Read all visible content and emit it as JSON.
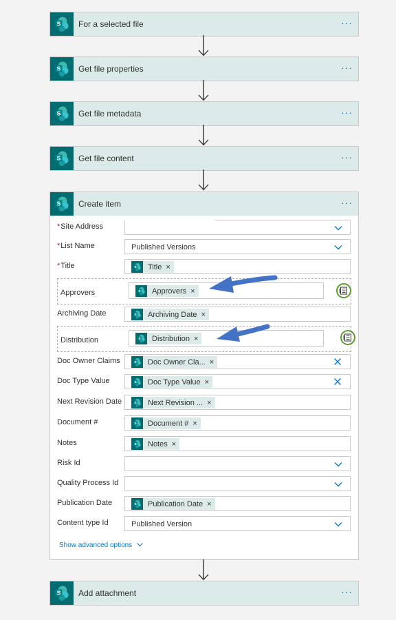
{
  "steps": [
    {
      "title": "For a selected file",
      "more": "···"
    },
    {
      "title": "Get file properties",
      "more": "···"
    },
    {
      "title": "Get file metadata",
      "more": "···"
    },
    {
      "title": "Get file content",
      "more": "···"
    }
  ],
  "create_item": {
    "title": "Create item",
    "more": "···",
    "required_mark": "*",
    "fields": {
      "site_address": {
        "label": "Site Address"
      },
      "list_name": {
        "label": "List Name",
        "value": "Published Versions"
      },
      "title": {
        "label": "Title",
        "token": "Title"
      },
      "approvers": {
        "label": "Approvers",
        "token": "Approvers"
      },
      "archiving_date": {
        "label": "Archiving Date",
        "token": "Archiving Date"
      },
      "distribution": {
        "label": "Distribution",
        "token": "Distribution"
      },
      "doc_owner_claims": {
        "label": "Doc Owner Claims",
        "token": "Doc Owner Cla..."
      },
      "doc_type_value": {
        "label": "Doc Type Value",
        "token": "Doc Type Value"
      },
      "next_revision_date": {
        "label": "Next Revision Date",
        "token": "Next Revision ..."
      },
      "document_number": {
        "label": "Document #",
        "token": "Document #"
      },
      "notes": {
        "label": "Notes",
        "token": "Notes"
      },
      "risk_id": {
        "label": "Risk Id"
      },
      "quality_process_id": {
        "label": "Quality Process Id"
      },
      "publication_date": {
        "label": "Publication Date",
        "token": "Publication Date"
      },
      "content_type_id": {
        "label": "Content type Id",
        "value": "Published Version"
      }
    },
    "token_remove": "×",
    "show_advanced": "Show advanced options"
  },
  "add_attachment": {
    "title": "Add attachment",
    "more": "···"
  },
  "colors": {
    "sharepoint": "#036c70",
    "header_bg": "#dcebea",
    "accent": "#0078d4",
    "highlight_circle": "#5a9e2c",
    "arrow": "#4472c4"
  },
  "icons": [
    "sharepoint-icon",
    "down-arrow-icon",
    "chevron-down-icon",
    "clear-x-icon",
    "switch-to-array-icon",
    "annotation-arrow-icon"
  ]
}
